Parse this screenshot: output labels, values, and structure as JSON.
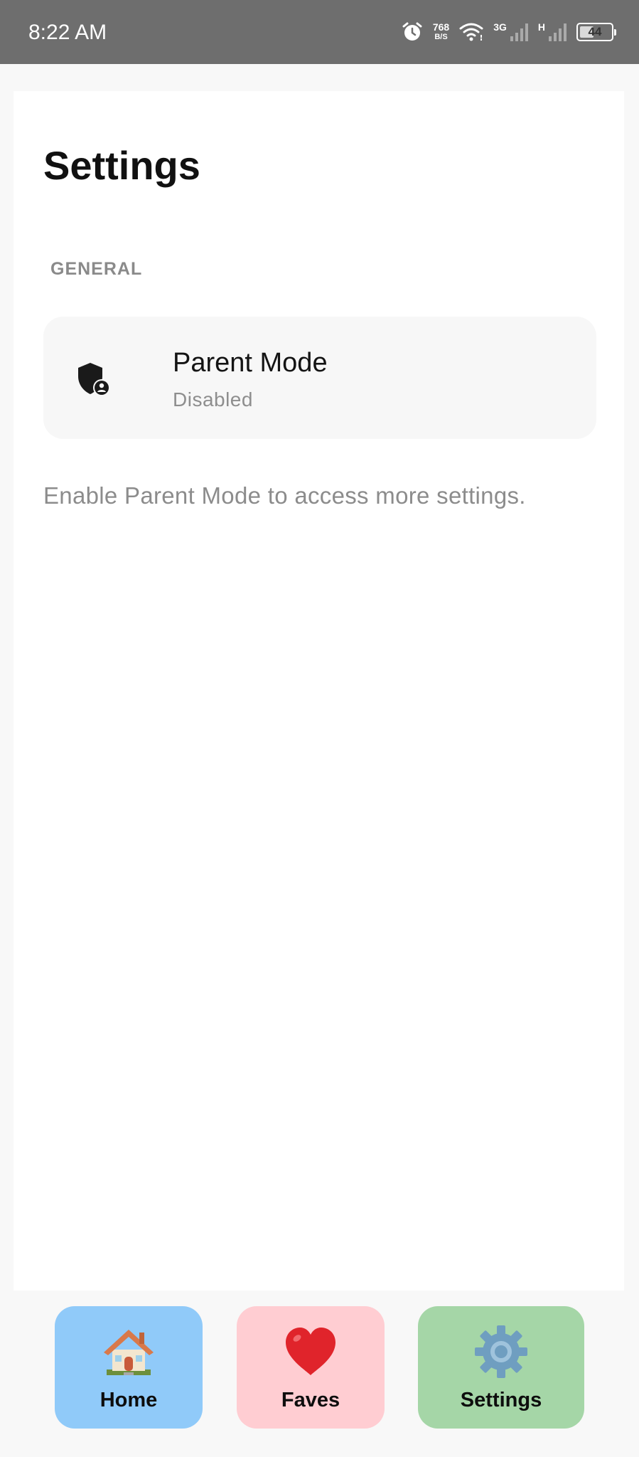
{
  "status_bar": {
    "time": "8:22 AM",
    "net_speed_value": "768",
    "net_speed_unit": "B/S",
    "network_1_label": "3G",
    "network_2_label": "H",
    "battery_level": "44",
    "icons": [
      "alarm-icon",
      "wifi-icon",
      "signal-icon",
      "battery-icon"
    ]
  },
  "page": {
    "title": "Settings",
    "section_header": "GENERAL",
    "parent_mode": {
      "icon": "shield-person-icon",
      "title": "Parent Mode",
      "status": "Disabled"
    },
    "hint": "Enable Parent Mode to access more settings."
  },
  "bottom_nav": {
    "items": [
      {
        "label": "Home",
        "icon": "house-icon",
        "color": "#90caf9"
      },
      {
        "label": "Faves",
        "icon": "heart-icon",
        "color": "#ffcdd2"
      },
      {
        "label": "Settings",
        "icon": "gear-icon",
        "color": "#a5d6a7"
      }
    ]
  }
}
